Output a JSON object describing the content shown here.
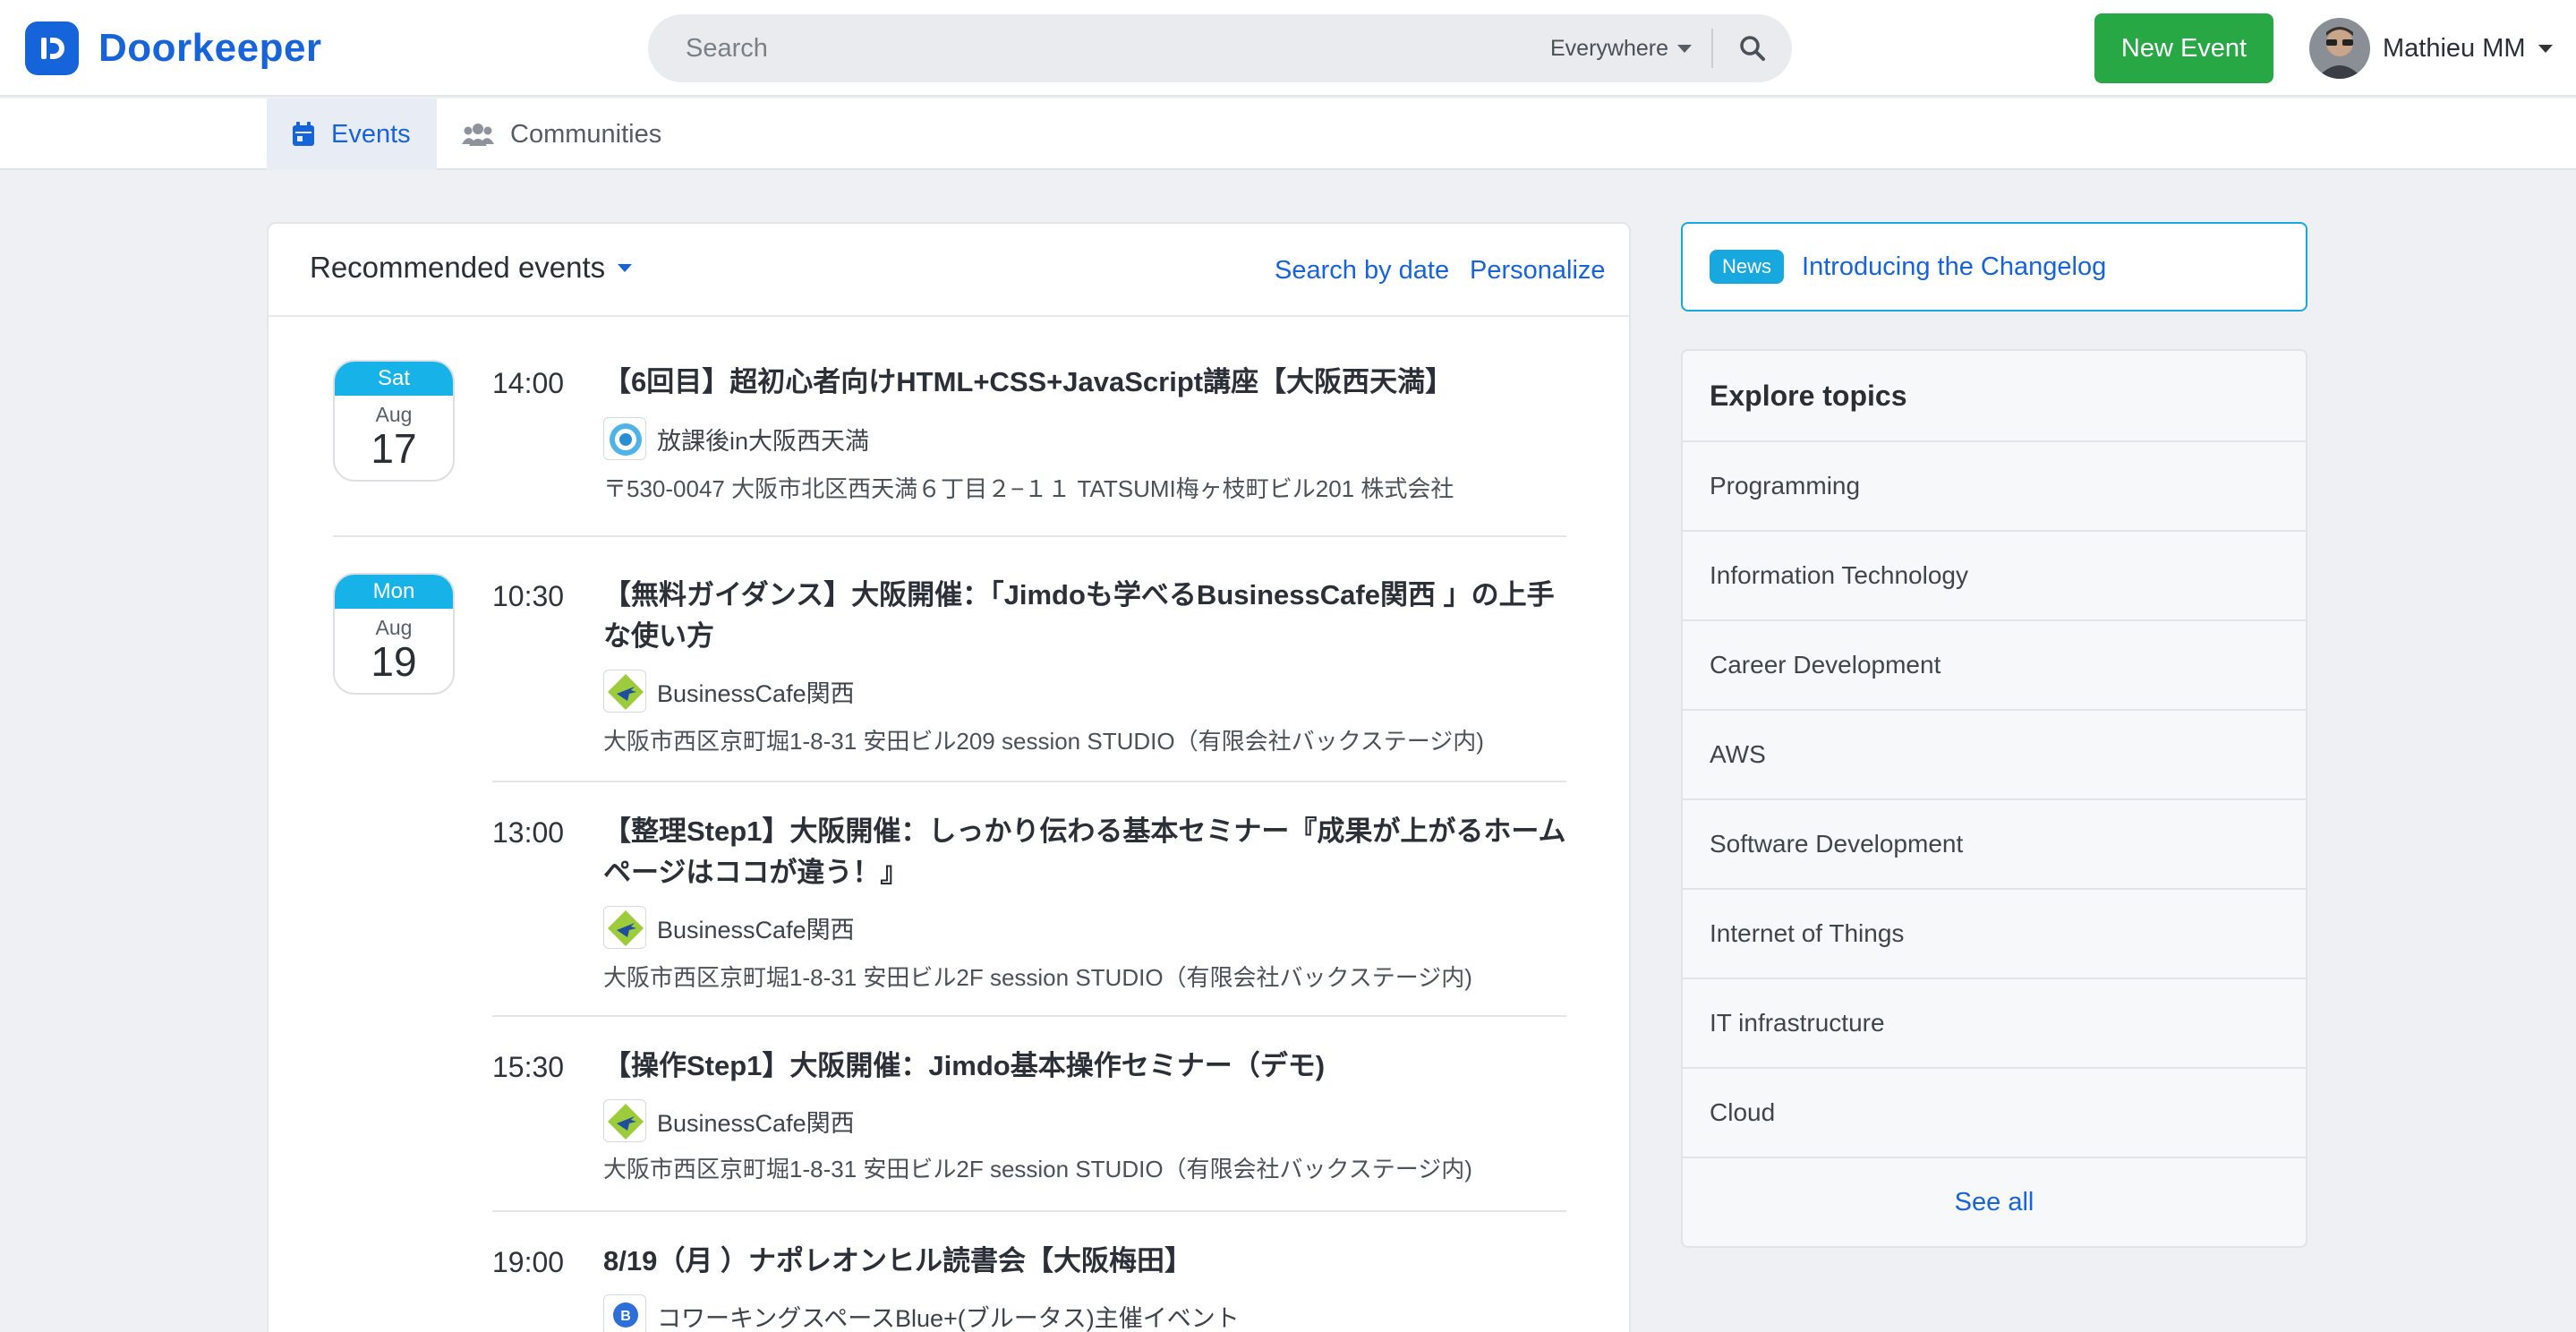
{
  "brand": {
    "name": "Doorkeeper",
    "icon": "doorkeeper-logo-icon",
    "color": "#1664d9"
  },
  "search": {
    "placeholder": "Search",
    "scope": "Everywhere",
    "icon": "search-icon"
  },
  "header": {
    "new_event_label": "New Event",
    "user_name": "Mathieu MM"
  },
  "tabs": [
    {
      "label": "Events",
      "icon": "calendar-icon",
      "active": true
    },
    {
      "label": "Communities",
      "icon": "users-icon",
      "active": false
    }
  ],
  "feed": {
    "title": "Recommended events",
    "search_by_date_label": "Search by date",
    "personalize_label": "Personalize",
    "days": [
      {
        "dow": "Sat",
        "month": "Aug",
        "day": "17",
        "events": [
          {
            "time": "14:00",
            "title": "【6回目】超初心者向けHTML+CSS+JavaScript講座【大阪西天満】",
            "group": "放課後in大阪西天満",
            "address": "〒530-0047 大阪市北区西天満６丁目２−１１ TATSUMI梅ヶ枝町ビル201 株式会社"
          }
        ]
      },
      {
        "dow": "Mon",
        "month": "Aug",
        "day": "19",
        "events": [
          {
            "time": "10:30",
            "title": "【無料ガイダンス】大阪開催：「Jimdoも学べるBusinessCafe関西 」の上手な使い方",
            "group": "BusinessCafe関西",
            "address": "大阪市西区京町堀1-8-31 安田ビル209 session STUDIO（有限会社バックステージ内)"
          },
          {
            "time": "13:00",
            "title": "【整理Step1】大阪開催：しっかり伝わる基本セミナー『成果が上がるホームページはココが違う！』",
            "group": "BusinessCafe関西",
            "address": "大阪市西区京町堀1-8-31 安田ビル2F session STUDIO（有限会社バックステージ内)"
          },
          {
            "time": "15:30",
            "title": "【操作Step1】大阪開催：Jimdo基本操作セミナー（デモ)",
            "group": "BusinessCafe関西",
            "address": "大阪市西区京町堀1-8-31 安田ビル2F session STUDIO（有限会社バックステージ内)"
          },
          {
            "time": "19:00",
            "title": "8/19（月 ）ナポレオンヒル読書会【大阪梅田】",
            "group": "コワーキングスペースBlue+(ブルータス)主催イベント",
            "address": ""
          }
        ]
      }
    ]
  },
  "news": {
    "badge": "News",
    "link": "Introducing the Changelog"
  },
  "topics": {
    "title": "Explore topics",
    "items": [
      "Programming",
      "Information Technology",
      "Career Development",
      "AWS",
      "Software Development",
      "Internet of Things",
      "IT infrastructure",
      "Cloud"
    ],
    "see_all": "See all"
  }
}
